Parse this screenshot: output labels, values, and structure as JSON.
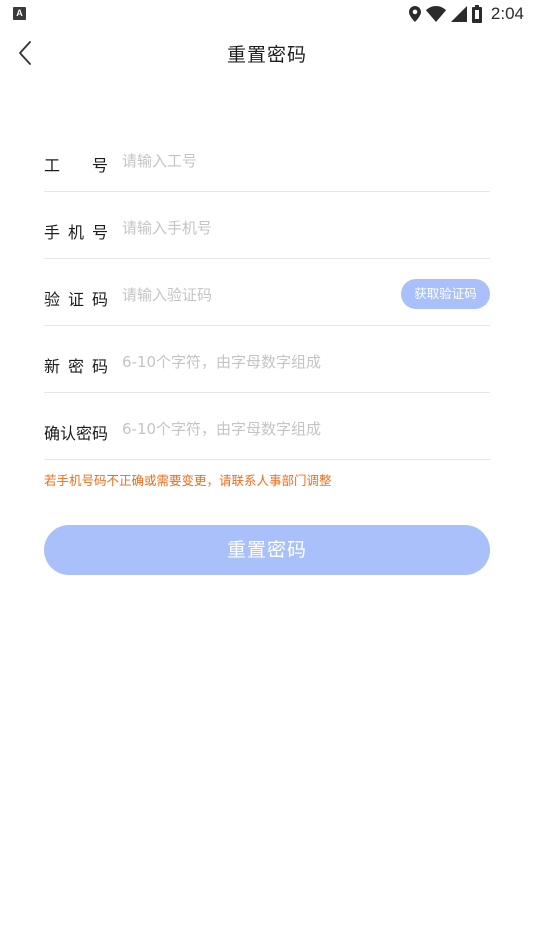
{
  "status_bar": {
    "app_icon_letter": "A",
    "time": "2:04",
    "icons": [
      "location-icon",
      "wifi-icon",
      "signal-icon",
      "battery-icon"
    ]
  },
  "header": {
    "title": "重置密码",
    "back_icon": "chevron-left-icon"
  },
  "form": {
    "employee_id": {
      "label_chars": [
        "工",
        "号"
      ],
      "placeholder": "请输入工号"
    },
    "phone": {
      "label_chars": [
        "手",
        "机",
        "号"
      ],
      "placeholder": "请输入手机号"
    },
    "code": {
      "label_chars": [
        "验",
        "证",
        "码"
      ],
      "placeholder": "请输入验证码",
      "button_label": "获取验证码"
    },
    "new_password": {
      "label_chars": [
        "新",
        "密",
        "码"
      ],
      "placeholder": "6-10个字符，由字母数字组成"
    },
    "confirm_password": {
      "label_chars": [
        "确",
        "认",
        "密",
        "码"
      ],
      "placeholder": "6-10个字符，由字母数字组成"
    }
  },
  "notice": "若手机号码不正确或需要变更，请联系人事部门调整",
  "submit_label": "重置密码",
  "colors": {
    "accent_disabled": "#a9c0fb",
    "notice": "#ef6c1a",
    "placeholder": "#c4c4c4",
    "divider": "#e6e6e6"
  }
}
